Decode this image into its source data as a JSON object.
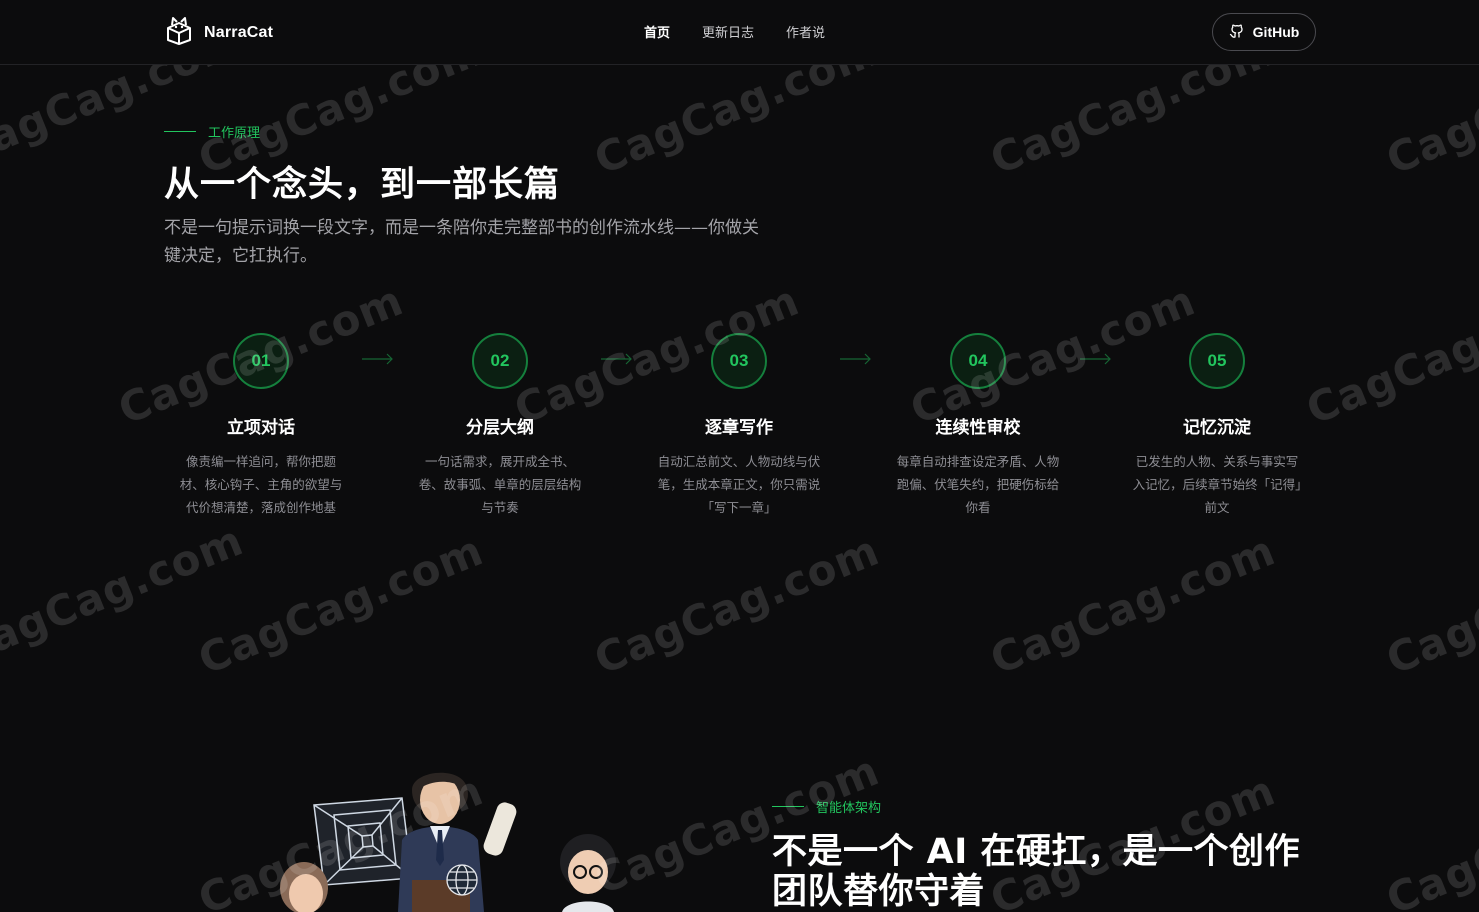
{
  "header": {
    "brand_name": "NarraCat",
    "nav": [
      {
        "label": "首页",
        "active": true
      },
      {
        "label": "更新日志",
        "active": false
      },
      {
        "label": "作者说",
        "active": false
      }
    ],
    "github_label": "GitHub"
  },
  "how_it_works": {
    "eyebrow": "工作原理",
    "title": "从一个念头，到一部长篇",
    "description": "不是一句提示词换一段文字，而是一条陪你走完整部书的创作流水线——你做关键决定，它扛执行。",
    "steps": [
      {
        "number": "01",
        "title": "立项对话",
        "description": "像责编一样追问，帮你把题材、核心钩子、主角的欲望与代价想清楚，落成创作地基"
      },
      {
        "number": "02",
        "title": "分层大纲",
        "description": "一句话需求，展开成全书、卷、故事弧、单章的层层结构与节奏"
      },
      {
        "number": "03",
        "title": "逐章写作",
        "description": "自动汇总前文、人物动线与伏笔，生成本章正文，你只需说「写下一章」"
      },
      {
        "number": "04",
        "title": "连续性审校",
        "description": "每章自动排查设定矛盾、人物跑偏、伏笔失约，把硬伤标给你看"
      },
      {
        "number": "05",
        "title": "记忆沉淀",
        "description": "已发生的人物、关系与事实写入记忆，后续章节始终「记得」前文"
      }
    ]
  },
  "agents": {
    "eyebrow": "智能体架构",
    "title": "不是一个 AI 在硬扛，是一个创作团队替你守着"
  },
  "watermark": "CagCag.com",
  "colors": {
    "background": "#0c0c0d",
    "accent": "#22c55e",
    "step_ring": "#15803d",
    "muted_text": "#8e8e94"
  },
  "icons": {
    "brand": "cat-box-logo-icon",
    "github": "github-icon",
    "step_arrow": "arrow-right-icon"
  }
}
